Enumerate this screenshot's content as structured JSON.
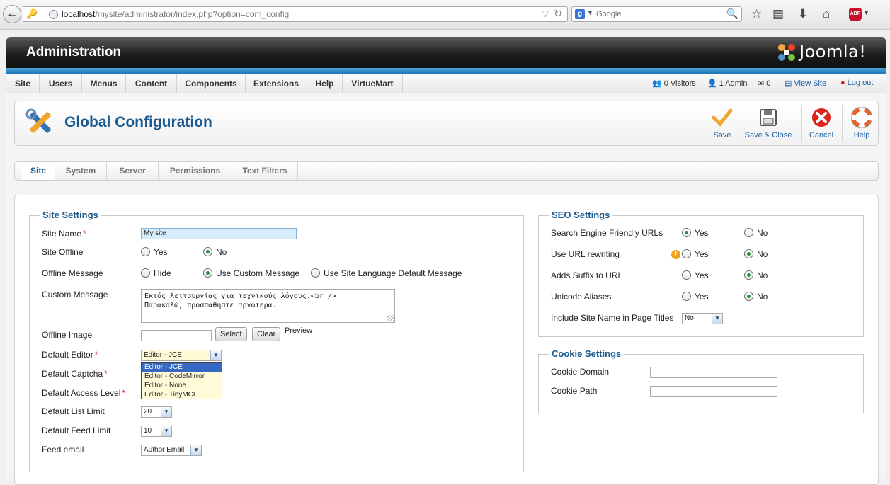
{
  "browser": {
    "url_host": "localhost",
    "url_path": "/mysite/administrator/index.php?option=com_config",
    "search_placeholder": "Google",
    "search_engine_letter": "g",
    "abp_label": "ABP"
  },
  "header": {
    "title": "Administration",
    "logo_text": "Joomla!"
  },
  "menu": {
    "items": [
      "Site",
      "Users",
      "Menus",
      "Content",
      "Components",
      "Extensions",
      "Help",
      "VirtueMart"
    ]
  },
  "status": {
    "visitors": "0 Visitors",
    "admins": "1 Admin",
    "messages": "0",
    "view_site": "View Site",
    "logout": "Log out"
  },
  "toolbar": {
    "title": "Global Configuration",
    "save": "Save",
    "save_close": "Save & Close",
    "cancel": "Cancel",
    "help": "Help"
  },
  "tabs": [
    "Site",
    "System",
    "Server",
    "Permissions",
    "Text Filters"
  ],
  "site_settings": {
    "legend": "Site Settings",
    "site_name_label": "Site Name",
    "site_name_value": "My site",
    "site_offline_label": "Site Offline",
    "yes": "Yes",
    "no": "No",
    "offline_message_label": "Offline Message",
    "offline_hide": "Hide",
    "offline_custom": "Use Custom Message",
    "offline_default": "Use Site Language Default Message",
    "custom_message_label": "Custom Message",
    "custom_message_line1": "Εκτός λειτουργίας για τεχνικούς λόγους.<br />",
    "custom_message_line2": "Παρακαλώ, προσπαθήστε αργότερα.",
    "offline_image_label": "Offline Image",
    "select_btn": "Select",
    "clear_btn": "Clear",
    "preview_label": "Preview",
    "default_editor_label": "Default Editor",
    "default_editor_value": "Editor - JCE",
    "editor_options": [
      "Editor - JCE",
      "Editor - CodeMirror",
      "Editor - None",
      "Editor - TinyMCE"
    ],
    "default_captcha_label": "Default Captcha",
    "default_access_label": "Default Access Level",
    "list_limit_label": "Default List Limit",
    "list_limit_value": "20",
    "feed_limit_label": "Default Feed Limit",
    "feed_limit_value": "10",
    "feed_email_label": "Feed email",
    "feed_email_value": "Author Email",
    "required_mark": "*"
  },
  "seo_settings": {
    "legend": "SEO Settings",
    "sef_label": "Search Engine Friendly URLs",
    "rewrite_label": "Use URL rewriting",
    "suffix_label": "Adds Suffix to URL",
    "unicode_label": "Unicode Aliases",
    "sitename_titles_label": "Include Site Name in Page Titles",
    "sitename_titles_value": "No",
    "yes": "Yes",
    "no": "No",
    "warn_glyph": "!"
  },
  "cookie_settings": {
    "legend": "Cookie Settings",
    "domain_label": "Cookie Domain",
    "path_label": "Cookie Path"
  },
  "colors": {
    "accent_blue": "#1b5a8e",
    "link_blue": "#1a5fa8",
    "radio_green": "#2a8f3a",
    "cancel_red": "#d9251d"
  }
}
